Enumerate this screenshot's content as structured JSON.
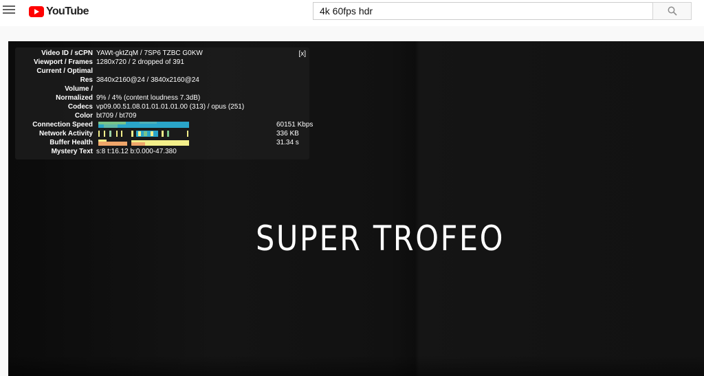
{
  "masthead": {
    "logo_text": "YouTube",
    "search_value": "4k 60fps hdr"
  },
  "stats": {
    "close_label": "[x]",
    "rows": [
      {
        "label": "Video ID / sCPN",
        "value": "YAWt-gktZqM / 7SP6 TZBC G0KW"
      },
      {
        "label": "Viewport / Frames",
        "value": "1280x720 / 2 dropped of 391"
      },
      {
        "label": "Current / Optimal",
        "value": ""
      },
      {
        "label": "Res",
        "value": "3840x2160@24 / 3840x2160@24"
      },
      {
        "label": "Volume /",
        "value": ""
      },
      {
        "label": "Normalized",
        "value": "9% / 4% (content loudness 7.3dB)"
      },
      {
        "label": "Codecs",
        "value": "vp09.00.51.08.01.01.01.01.00 (313) / opus (251)"
      },
      {
        "label": "Color",
        "value": "bt709 / bt709"
      },
      {
        "label": "Connection Speed",
        "value": "60151 Kbps"
      },
      {
        "label": "Network Activity",
        "value": "336 KB"
      },
      {
        "label": "Buffer Health",
        "value": "31.34 s"
      },
      {
        "label": "Mystery Text",
        "value": "s:8 t:16.12 b:0.000-47.380"
      }
    ]
  },
  "video": {
    "title_text": "SUPER TROFEO"
  },
  "colors": {
    "youtube_red": "#ff0000",
    "graph_cyan": "#2aa5c9",
    "graph_green": "#78c38a",
    "graph_yellow": "#f3ef8a",
    "graph_orange": "#f0a66a"
  },
  "icons": [
    "menu-icon",
    "youtube-logo-icon",
    "search-icon"
  ]
}
